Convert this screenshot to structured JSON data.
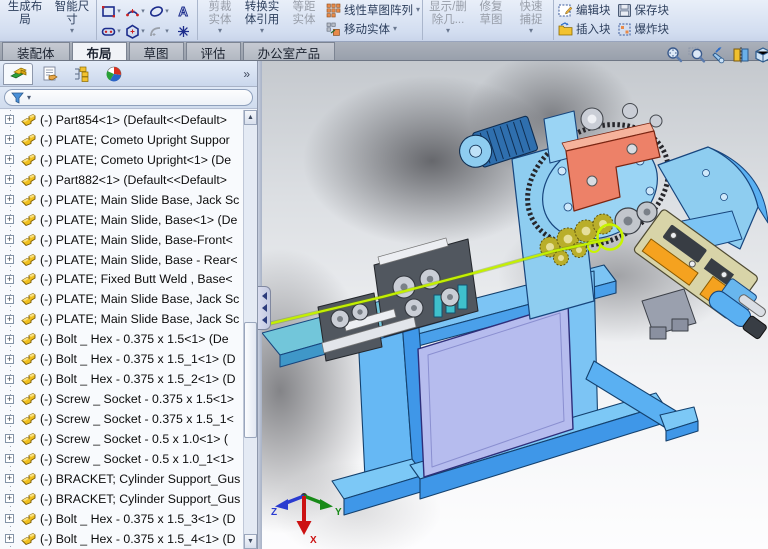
{
  "ribbon": {
    "create_layout": "生成布局",
    "smart_dimension": "智能尺寸",
    "trim_entities": "剪裁实体",
    "convert_entities": "转换实体引用",
    "offset_entities": "等距实体",
    "linear_sketch_pattern": "线性草图阵列",
    "move_entities": "移动实体",
    "display_delete_relations": "显示/删除几...",
    "repair_sketch": "修复草图",
    "quick_snaps": "快速捕捉",
    "edit_block": "编辑块",
    "insert_block": "插入块",
    "save_block": "保存块",
    "explode_block": "爆炸块"
  },
  "tabs": [
    {
      "label": "装配体"
    },
    {
      "label": "布局",
      "active": true
    },
    {
      "label": "草图"
    },
    {
      "label": "评估"
    },
    {
      "label": "办公室产品"
    }
  ],
  "feature_tree": {
    "items": [
      "(-) Part854<1> (Default<<Default>",
      "(-) PLATE; Cometo Upright Suppor",
      "(-) PLATE; Cometo Upright<1> (De",
      "(-) Part882<1> (Default<<Default>",
      "(-) PLATE; Main Slide Base, Jack Sc",
      "(-) PLATE; Main Slide, Base<1> (De",
      "(-) PLATE; Main Slide, Base-Front<",
      "(-) PLATE; Main Slide, Base - Rear<",
      "(-) PLATE; Fixed Butt Weld , Base<",
      "(-) PLATE; Main Slide Base, Jack Sc",
      "(-) PLATE; Main Slide Base, Jack Sc",
      "(-) Bolt _ Hex - 0.375 x 1.5<1> (De",
      "(-) Bolt _ Hex - 0.375 x 1.5_1<1> (D",
      "(-) Bolt _ Hex - 0.375 x 1.5_2<1> (D",
      "(-) Screw _ Socket - 0.375 x 1.5<1>",
      "(-) Screw _ Socket - 0.375 x 1.5_1<",
      "(-) Screw _ Socket - 0.5 x 1.0<1> (",
      "(-) Screw _ Socket - 0.5 x 1.0_1<1>",
      "(-) BRACKET; Cylinder Support_Gus",
      "(-) BRACKET; Cylinder Support_Gus",
      "(-) Bolt _ Hex - 0.375 x 1.5_3<1> (D",
      "(-) Bolt _ Hex - 0.375 x 1.5_4<1> (D"
    ]
  },
  "triad": {
    "x": "X",
    "y": "Y",
    "z": "Z"
  },
  "glyphs": {
    "dropdown": "▾",
    "chevron_right": "»",
    "plus": "+",
    "up_arrow": "▲",
    "down_arrow": "▼"
  },
  "colors": {
    "machine_blue": "#8ecdf0",
    "machine_blue_dark": "#3f97e8",
    "panel_lavender": "#b6bcee",
    "salmon_block": "#ed8168",
    "wire_green": "#c4f000",
    "tooling_orange": "#f5a21f",
    "edge_navy": "#14416e"
  }
}
